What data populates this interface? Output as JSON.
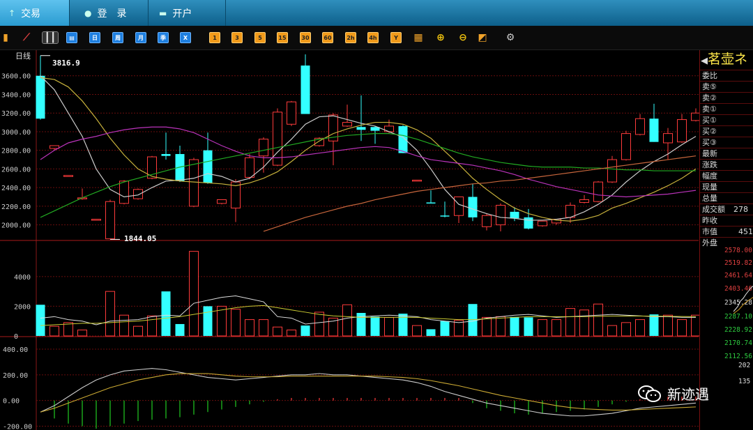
{
  "tabs": [
    {
      "label": "交易",
      "icon": "trade-icon",
      "active": true
    },
    {
      "label": "登　录",
      "icon": "user-icon",
      "active": false
    },
    {
      "label": "开户",
      "icon": "monitor-icon",
      "active": false
    }
  ],
  "toolbar": {
    "period_buttons": [
      "日",
      "周",
      "月",
      "季",
      "X"
    ],
    "minute_buttons": [
      "1",
      "3",
      "5",
      "15",
      "30",
      "60",
      "2h",
      "4h",
      "Y"
    ]
  },
  "chart": {
    "period_label": "日线",
    "price_ticks": [
      "3600.00",
      "3400.00",
      "3200.00",
      "3000.00",
      "2800.00",
      "2600.00",
      "2400.00",
      "2200.00",
      "2000.00"
    ],
    "volume_ticks": [
      "4000",
      "2000",
      "0"
    ],
    "macd_ticks": [
      "400.00",
      "200.00",
      "0.00",
      "-200.00"
    ],
    "high_label": "3816.9",
    "low_label": "1844.05"
  },
  "chart_data": {
    "type": "candlestick",
    "price_range": [
      1840,
      3830
    ],
    "candles": [
      {
        "o": 3600,
        "h": 3816.9,
        "l": 3130,
        "c": 3140
      },
      {
        "o": 2820,
        "h": 2840,
        "l": 2800,
        "c": 2850
      },
      {
        "o": 2530,
        "h": 2530,
        "l": 2530,
        "c": 2530
      },
      {
        "o": 2280,
        "h": 2390,
        "l": 2270,
        "c": 2290
      },
      {
        "o": 2060,
        "h": 2060,
        "l": 2050,
        "c": 2060
      },
      {
        "o": 1850,
        "h": 2270,
        "l": 1844.05,
        "c": 2250
      },
      {
        "o": 2230,
        "h": 2480,
        "l": 2220,
        "c": 2470
      },
      {
        "o": 2280,
        "h": 2390,
        "l": 2270,
        "c": 2380
      },
      {
        "o": 2500,
        "h": 2740,
        "l": 2490,
        "c": 2730
      },
      {
        "o": 2760,
        "h": 2990,
        "l": 2700,
        "c": 2740
      },
      {
        "o": 2760,
        "h": 2850,
        "l": 2460,
        "c": 2470
      },
      {
        "o": 2200,
        "h": 2720,
        "l": 2190,
        "c": 2700
      },
      {
        "o": 2800,
        "h": 2990,
        "l": 2440,
        "c": 2450
      },
      {
        "o": 2230,
        "h": 2250,
        "l": 2220,
        "c": 2270
      },
      {
        "o": 2180,
        "h": 2490,
        "l": 2030,
        "c": 2460
      },
      {
        "o": 2510,
        "h": 2760,
        "l": 2490,
        "c": 2720
      },
      {
        "o": 2740,
        "h": 2940,
        "l": 2560,
        "c": 2920
      },
      {
        "o": 2640,
        "h": 3250,
        "l": 2630,
        "c": 3210
      },
      {
        "o": 3080,
        "h": 3330,
        "l": 3060,
        "c": 3320
      },
      {
        "o": 3710,
        "h": 3830,
        "l": 3200,
        "c": 3190
      },
      {
        "o": 2850,
        "h": 2940,
        "l": 2840,
        "c": 2930
      },
      {
        "o": 2900,
        "h": 3200,
        "l": 2640,
        "c": 3180
      },
      {
        "o": 3060,
        "h": 3290,
        "l": 3050,
        "c": 3100
      },
      {
        "o": 3050,
        "h": 3390,
        "l": 2900,
        "c": 3020
      },
      {
        "o": 3050,
        "h": 3060,
        "l": 2870,
        "c": 3010
      },
      {
        "o": 3000,
        "h": 3130,
        "l": 2980,
        "c": 3060
      },
      {
        "o": 3060,
        "h": 3070,
        "l": 2770,
        "c": 2770
      },
      {
        "o": 2480,
        "h": 2480,
        "l": 2480,
        "c": 2480
      },
      {
        "o": 2240,
        "h": 2370,
        "l": 2230,
        "c": 2230
      },
      {
        "o": 2100,
        "h": 2250,
        "l": 2080,
        "c": 2090
      },
      {
        "o": 2100,
        "h": 2300,
        "l": 2020,
        "c": 2300
      },
      {
        "o": 2300,
        "h": 2440,
        "l": 2040,
        "c": 2080
      },
      {
        "o": 1980,
        "h": 2120,
        "l": 1940,
        "c": 2100
      },
      {
        "o": 2000,
        "h": 2230,
        "l": 1930,
        "c": 2210
      },
      {
        "o": 2140,
        "h": 2190,
        "l": 2040,
        "c": 2070
      },
      {
        "o": 2080,
        "h": 2170,
        "l": 1950,
        "c": 1960
      },
      {
        "o": 1990,
        "h": 2040,
        "l": 1980,
        "c": 2040
      },
      {
        "o": 2020,
        "h": 2050,
        "l": 2000,
        "c": 2060
      },
      {
        "o": 2080,
        "h": 2240,
        "l": 2020,
        "c": 2210
      },
      {
        "o": 2240,
        "h": 2320,
        "l": 2230,
        "c": 2270
      },
      {
        "o": 2250,
        "h": 2470,
        "l": 2240,
        "c": 2460
      },
      {
        "o": 2460,
        "h": 2740,
        "l": 2450,
        "c": 2700
      },
      {
        "o": 2700,
        "h": 3010,
        "l": 2690,
        "c": 2980
      },
      {
        "o": 2970,
        "h": 3190,
        "l": 2960,
        "c": 3140
      },
      {
        "o": 3140,
        "h": 3300,
        "l": 2890,
        "c": 2890
      },
      {
        "o": 2880,
        "h": 3040,
        "l": 2700,
        "c": 2980
      },
      {
        "o": 2890,
        "h": 3190,
        "l": 2880,
        "c": 3130
      },
      {
        "o": 3120,
        "h": 3250,
        "l": 3110,
        "c": 3200
      }
    ],
    "volume": [
      2100,
      650,
      900,
      400,
      0,
      3000,
      1400,
      650,
      1350,
      3000,
      800,
      5700,
      2000,
      2000,
      1800,
      1100,
      1100,
      600,
      400,
      700,
      1600,
      1200,
      2100,
      1550,
      1300,
      1250,
      1500,
      700,
      450,
      1000,
      1050,
      2150,
      1250,
      1300,
      1280,
      1250,
      1100,
      1100,
      1850,
      1750,
      2150,
      700,
      900,
      1100,
      1450,
      1400,
      1100,
      1400
    ],
    "ma_price": [
      {
        "name": "MA5",
        "color": "#cccccc",
        "values": [
          3600,
          3450,
          3200,
          2950,
          2600,
          2380,
          2300,
          2320,
          2400,
          2470,
          2480,
          2500,
          2550,
          2520,
          2460,
          2500,
          2620,
          2780,
          2920,
          3080,
          3160,
          3170,
          3130,
          3090,
          3060,
          3000,
          2940,
          2800,
          2600,
          2380,
          2220,
          2170,
          2120,
          2080,
          2070,
          2050,
          2050,
          2060,
          2080,
          2140,
          2220,
          2320,
          2460,
          2580,
          2680,
          2760,
          2860,
          2950
        ]
      },
      {
        "name": "MA10",
        "color": "#c8b23c",
        "values": [
          3580,
          3560,
          3480,
          3330,
          3140,
          2930,
          2750,
          2600,
          2520,
          2490,
          2470,
          2460,
          2450,
          2440,
          2420,
          2450,
          2500,
          2570,
          2680,
          2800,
          2900,
          2980,
          3030,
          3070,
          3100,
          3100,
          3080,
          3020,
          2930,
          2790,
          2650,
          2500,
          2380,
          2270,
          2180,
          2120,
          2080,
          2050,
          2040,
          2060,
          2100,
          2180,
          2230,
          2290,
          2350,
          2420,
          2500,
          2600
        ]
      },
      {
        "name": "MA20",
        "color": "#bb33bb",
        "values": [
          2700,
          2800,
          2880,
          2920,
          2950,
          2990,
          3020,
          3040,
          3050,
          3050,
          3030,
          2990,
          2920,
          2850,
          2790,
          2740,
          2720,
          2720,
          2730,
          2750,
          2770,
          2790,
          2810,
          2830,
          2840,
          2830,
          2790,
          2740,
          2700,
          2680,
          2660,
          2640,
          2610,
          2580,
          2540,
          2490,
          2450,
          2410,
          2380,
          2350,
          2320,
          2310,
          2300,
          2310,
          2320,
          2330,
          2350,
          2370
        ]
      },
      {
        "name": "MA30",
        "color": "#22aa22",
        "values": [
          2080,
          2150,
          2220,
          2290,
          2350,
          2410,
          2460,
          2500,
          2540,
          2580,
          2620,
          2650,
          2680,
          2710,
          2740,
          2770,
          2800,
          2830,
          2860,
          2890,
          2920,
          2940,
          2960,
          2970,
          2980,
          2980,
          2960,
          2920,
          2870,
          2820,
          2770,
          2730,
          2700,
          2670,
          2650,
          2630,
          2620,
          2620,
          2620,
          2610,
          2610,
          2600,
          2590,
          2590,
          2580,
          2580,
          2580,
          2580
        ]
      }
    ],
    "ma_long": {
      "name": "MA60",
      "color": "#c8663c",
      "start_index": 16,
      "values": [
        1930,
        1980,
        2030,
        2080,
        2120,
        2160,
        2200,
        2230,
        2270,
        2300,
        2330,
        2360,
        2380,
        2400,
        2420,
        2440,
        2450,
        2470,
        2480,
        2500,
        2520,
        2540,
        2560,
        2580,
        2600,
        2620,
        2640,
        2660,
        2680,
        2700,
        2720,
        2740
      ]
    },
    "volume_ma": [
      {
        "name": "VMA5",
        "color": "#dddddd",
        "values": [
          1200,
          1300,
          1100,
          1000,
          750,
          1000,
          1050,
          1100,
          1300,
          1400,
          1350,
          2200,
          2400,
          2600,
          2700,
          2500,
          2300,
          1300,
          1200,
          800,
          900,
          1000,
          1200,
          1300,
          1350,
          1400,
          1350,
          1300,
          1100,
          1000,
          900,
          1000,
          1200,
          1300,
          1400,
          1450,
          1350,
          1250,
          1300,
          1350,
          1400,
          1450,
          1400,
          1350,
          1300,
          1300,
          1250,
          1250
        ]
      },
      {
        "name": "VMA10",
        "color": "#cccc33",
        "values": [
          700,
          750,
          800,
          850,
          850,
          900,
          950,
          1000,
          1100,
          1200,
          1300,
          1450,
          1600,
          1750,
          1900,
          2000,
          2050,
          1900,
          1750,
          1600,
          1450,
          1350,
          1300,
          1250,
          1250,
          1250,
          1250,
          1250,
          1200,
          1150,
          1100,
          1100,
          1150,
          1200,
          1250,
          1300,
          1300,
          1300,
          1300,
          1300,
          1320,
          1340,
          1340,
          1340,
          1330,
          1320,
          1310,
          1300
        ]
      }
    ],
    "macd_lines": [
      {
        "name": "DIF",
        "color": "#cccccc",
        "values": [
          -90,
          -40,
          30,
          100,
          160,
          200,
          230,
          240,
          250,
          240,
          220,
          200,
          180,
          170,
          160,
          170,
          180,
          190,
          200,
          200,
          210,
          200,
          200,
          190,
          180,
          170,
          160,
          140,
          110,
          70,
          40,
          10,
          -20,
          -40,
          -60,
          -80,
          -100,
          -110,
          -120,
          -120,
          -110,
          -100,
          -80,
          -60,
          -50,
          -40,
          -30,
          -20
        ]
      },
      {
        "name": "DEA",
        "color": "#ccaa33",
        "values": [
          -90,
          -60,
          -20,
          20,
          60,
          100,
          130,
          160,
          180,
          200,
          210,
          210,
          210,
          200,
          190,
          185,
          185,
          185,
          190,
          190,
          190,
          190,
          190,
          190,
          190,
          185,
          180,
          170,
          155,
          135,
          115,
          90,
          65,
          40,
          20,
          0,
          -20,
          -40,
          -55,
          -65,
          -70,
          -75,
          -75,
          -70,
          -65,
          -60,
          -55,
          -50
        ]
      }
    ],
    "macd_bars": [
      0,
      -140,
      -180,
      -200,
      -220,
      -200,
      -180,
      -160,
      -150,
      -140,
      -130,
      -110,
      -90,
      -70,
      -50,
      -30,
      -10,
      10,
      20,
      20,
      20,
      20,
      20,
      20,
      20,
      20,
      20,
      20,
      20,
      20,
      20,
      -20,
      -60,
      -80,
      -100,
      -110,
      -100,
      -90,
      -80,
      -70,
      -50,
      -30,
      -10,
      10,
      20,
      30,
      30,
      30
    ]
  },
  "right_panel": {
    "stock_name": "茗壶ネ",
    "rows": [
      "委比",
      "卖⑤",
      "卖②",
      "卖①",
      "买①",
      "买②",
      "买③",
      "最新",
      "涨跌",
      "幅度",
      "现量",
      "总量",
      "成交额",
      "昨收",
      "市值",
      "外盘"
    ],
    "amount_value": "278",
    "market_cap_value": "451",
    "mini_prices": [
      "2578.00",
      "2519.82",
      "2461.64",
      "2403.46",
      "2345.28",
      "2287.10",
      "2228.92",
      "2170.74",
      "2112.56"
    ],
    "mini_vol": [
      "202",
      "135"
    ]
  },
  "watermark": {
    "text": "新迹遇"
  }
}
